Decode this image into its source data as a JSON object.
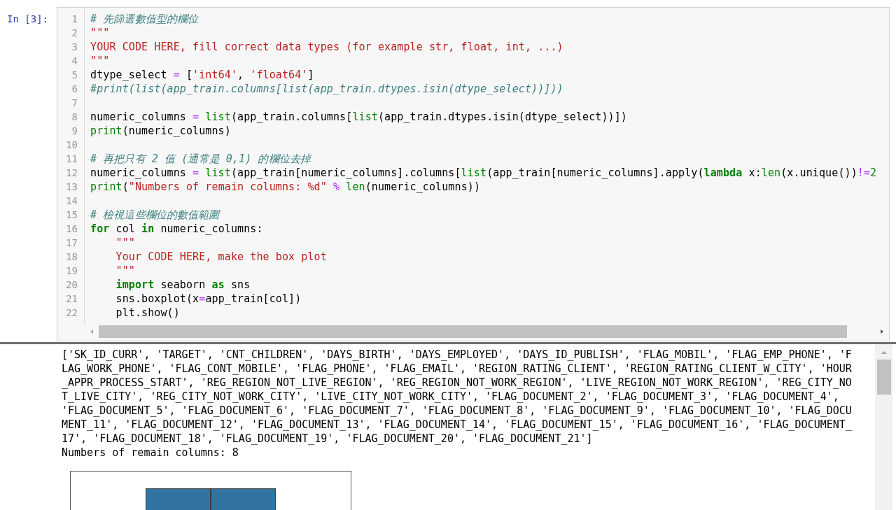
{
  "cell": {
    "prompt": "In [3]:",
    "code_lines": [
      {
        "number": "1",
        "tokens": [
          {
            "kind": "comment",
            "text": "# 先篩選數值型的欄位"
          }
        ]
      },
      {
        "number": "2",
        "tokens": [
          {
            "kind": "string",
            "text": "\"\"\""
          }
        ]
      },
      {
        "number": "3",
        "tokens": [
          {
            "kind": "string",
            "text": "YOUR CODE HERE, fill correct data types (for example str, float, int, ...)"
          }
        ]
      },
      {
        "number": "4",
        "tokens": [
          {
            "kind": "string",
            "text": "\"\"\""
          }
        ]
      },
      {
        "number": "5",
        "tokens": [
          {
            "kind": "plain",
            "text": "dtype_select "
          },
          {
            "kind": "operator",
            "text": "="
          },
          {
            "kind": "plain",
            "text": " ["
          },
          {
            "kind": "string",
            "text": "'int64'"
          },
          {
            "kind": "plain",
            "text": ", "
          },
          {
            "kind": "string",
            "text": "'float64'"
          },
          {
            "kind": "plain",
            "text": "]"
          }
        ]
      },
      {
        "number": "6",
        "tokens": [
          {
            "kind": "comment",
            "text": "#print(list(app_train.columns[list(app_train.dtypes.isin(dtype_select))]))"
          }
        ]
      },
      {
        "number": "7"
      },
      {
        "number": "8",
        "tokens": [
          {
            "kind": "plain",
            "text": "numeric_columns "
          },
          {
            "kind": "operator",
            "text": "= "
          },
          {
            "kind": "builtin",
            "text": "list"
          },
          {
            "kind": "plain",
            "text": "(app_train.columns["
          },
          {
            "kind": "builtin",
            "text": "list"
          },
          {
            "kind": "plain",
            "text": "(app_train.dtypes.isin(dtype_select))])"
          }
        ]
      },
      {
        "number": "9",
        "tokens": [
          {
            "kind": "builtin",
            "text": "print"
          },
          {
            "kind": "plain",
            "text": "(numeric_columns)"
          }
        ]
      },
      {
        "number": "10"
      },
      {
        "number": "11",
        "tokens": [
          {
            "kind": "comment",
            "text": "# 再把只有 2 值 (通常是 0,1) 的欄位去掉"
          }
        ]
      },
      {
        "number": "12",
        "tokens": [
          {
            "kind": "plain",
            "text": "numeric_columns "
          },
          {
            "kind": "operator",
            "text": "= "
          },
          {
            "kind": "builtin",
            "text": "list"
          },
          {
            "kind": "plain",
            "text": "(app_train[numeric_columns].columns["
          },
          {
            "kind": "builtin",
            "text": "list"
          },
          {
            "kind": "plain",
            "text": "(app_train[numeric_columns].apply("
          },
          {
            "kind": "keyword",
            "text": "lambda"
          },
          {
            "kind": "plain",
            "text": " x:"
          },
          {
            "kind": "builtin",
            "text": "len"
          },
          {
            "kind": "plain",
            "text": "(x.unique())"
          },
          {
            "kind": "operator",
            "text": "!="
          },
          {
            "kind": "number",
            "text": "2"
          }
        ]
      },
      {
        "number": "13",
        "tokens": [
          {
            "kind": "builtin",
            "text": "print"
          },
          {
            "kind": "plain",
            "text": "("
          },
          {
            "kind": "string",
            "text": "\"Numbers of remain columns: %d\""
          },
          {
            "kind": "operator",
            "text": " % "
          },
          {
            "kind": "builtin",
            "text": "len"
          },
          {
            "kind": "plain",
            "text": "(numeric_columns))"
          }
        ]
      },
      {
        "number": "14"
      },
      {
        "number": "15",
        "tokens": [
          {
            "kind": "comment",
            "text": "# 檢視這些欄位的數值範圍"
          }
        ]
      },
      {
        "number": "16",
        "tokens": [
          {
            "kind": "keyword",
            "text": "for"
          },
          {
            "kind": "plain",
            "text": " col "
          },
          {
            "kind": "keyword",
            "text": "in"
          },
          {
            "kind": "plain",
            "text": " numeric_columns:"
          }
        ]
      },
      {
        "number": "17",
        "tokens": [
          {
            "kind": "string",
            "text": "    \"\"\""
          }
        ]
      },
      {
        "number": "18",
        "tokens": [
          {
            "kind": "string",
            "text": "    Your CODE HERE, make the box plot"
          }
        ]
      },
      {
        "number": "19",
        "tokens": [
          {
            "kind": "string",
            "text": "    \"\"\""
          }
        ]
      },
      {
        "number": "20",
        "tokens": [
          {
            "kind": "keyword",
            "text": "    import"
          },
          {
            "kind": "plain",
            "text": " seaborn "
          },
          {
            "kind": "keyword",
            "text": "as"
          },
          {
            "kind": "plain",
            "text": " sns"
          }
        ]
      },
      {
        "number": "21",
        "tokens": [
          {
            "kind": "plain",
            "text": "    sns.boxplot(x"
          },
          {
            "kind": "operator",
            "text": "="
          },
          {
            "kind": "plain",
            "text": "app_train[col])"
          }
        ]
      },
      {
        "number": "22",
        "tokens": [
          {
            "kind": "plain",
            "text": "    plt.show()"
          }
        ]
      }
    ]
  },
  "output": {
    "lines": [
      "['SK_ID_CURR', 'TARGET', 'CNT_CHILDREN', 'DAYS_BIRTH', 'DAYS_EMPLOYED', 'DAYS_ID_PUBLISH', 'FLAG_MOBIL', 'FLAG_EMP_PHONE', 'F",
      "LAG_WORK_PHONE', 'FLAG_CONT_MOBILE', 'FLAG_PHONE', 'FLAG_EMAIL', 'REGION_RATING_CLIENT', 'REGION_RATING_CLIENT_W_CITY', 'HOUR",
      "_APPR_PROCESS_START', 'REG_REGION_NOT_LIVE_REGION', 'REG_REGION_NOT_WORK_REGION', 'LIVE_REGION_NOT_WORK_REGION', 'REG_CITY_NO",
      "T_LIVE_CITY', 'REG_CITY_NOT_WORK_CITY', 'LIVE_CITY_NOT_WORK_CITY', 'FLAG_DOCUMENT_2', 'FLAG_DOCUMENT_3', 'FLAG_DOCUMENT_4',",
      "'FLAG_DOCUMENT_5', 'FLAG_DOCUMENT_6', 'FLAG_DOCUMENT_7', 'FLAG_DOCUMENT_8', 'FLAG_DOCUMENT_9', 'FLAG_DOCUMENT_10', 'FLAG_DOCU",
      "MENT_11', 'FLAG_DOCUMENT_12', 'FLAG_DOCUMENT_13', 'FLAG_DOCUMENT_14', 'FLAG_DOCUMENT_15', 'FLAG_DOCUMENT_16', 'FLAG_DOCUMENT_",
      "17', 'FLAG_DOCUMENT_18', 'FLAG_DOCUMENT_19', 'FLAG_DOCUMENT_20', 'FLAG_DOCUMENT_21']",
      "Numbers of remain columns: 8"
    ]
  }
}
